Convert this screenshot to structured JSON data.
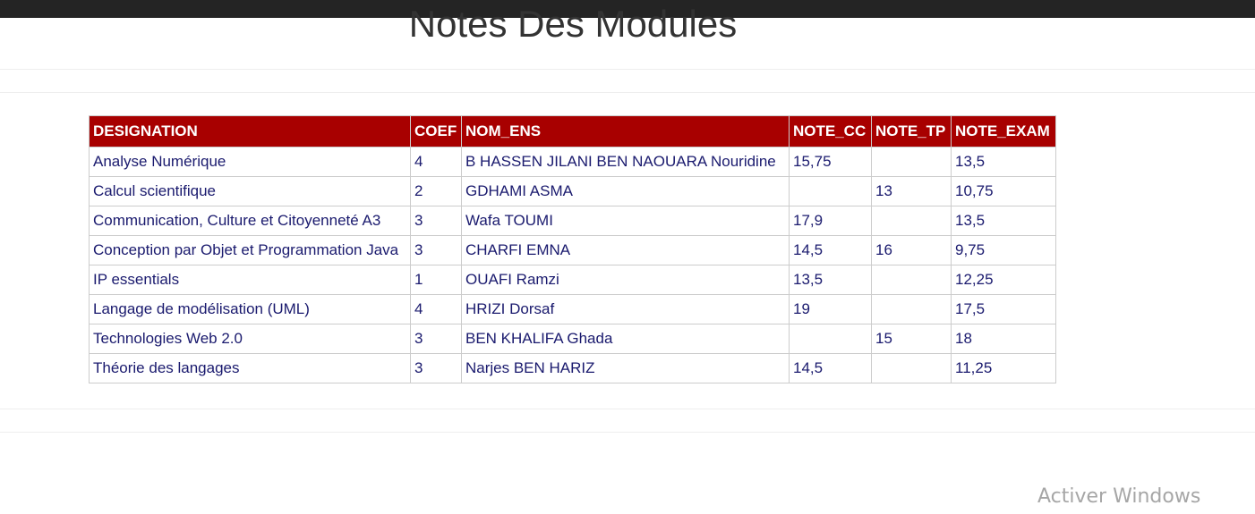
{
  "page": {
    "title": "Notes Des Modules"
  },
  "table": {
    "headers": [
      "DESIGNATION",
      "COEF",
      "NOM_ENS",
      "NOTE_CC",
      "NOTE_TP",
      "NOTE_EXAM"
    ],
    "rows": [
      [
        "Analyse Numérique",
        "4",
        "B HASSEN JILANI BEN NAOUARA Nouridine",
        "15,75",
        "",
        "13,5"
      ],
      [
        "Calcul scientifique",
        "2",
        "GDHAMI ASMA",
        "",
        "13",
        "10,75"
      ],
      [
        "Communication, Culture et Citoyenneté A3",
        "3",
        "Wafa TOUMI",
        "17,9",
        "",
        "13,5"
      ],
      [
        "Conception par Objet et Programmation Java",
        "3",
        "CHARFI EMNA",
        "14,5",
        "16",
        "9,75"
      ],
      [
        "IP essentials",
        "1",
        "OUAFI Ramzi",
        "13,5",
        "",
        "12,25"
      ],
      [
        "Langage de modélisation (UML)",
        "4",
        "HRIZI Dorsaf",
        "19",
        "",
        "17,5"
      ],
      [
        "Technologies Web 2.0",
        "3",
        "BEN KHALIFA Ghada",
        "",
        "15",
        "18"
      ],
      [
        "Théorie des langages",
        "3",
        "Narjes BEN HARIZ",
        "14,5",
        "",
        "11,25"
      ]
    ]
  },
  "watermark": {
    "text": "Activer Windows"
  },
  "colors": {
    "header_bg": "#a80000",
    "header_text": "#ffffff",
    "cell_text": "#1a1a6e",
    "topbar": "#242424"
  }
}
